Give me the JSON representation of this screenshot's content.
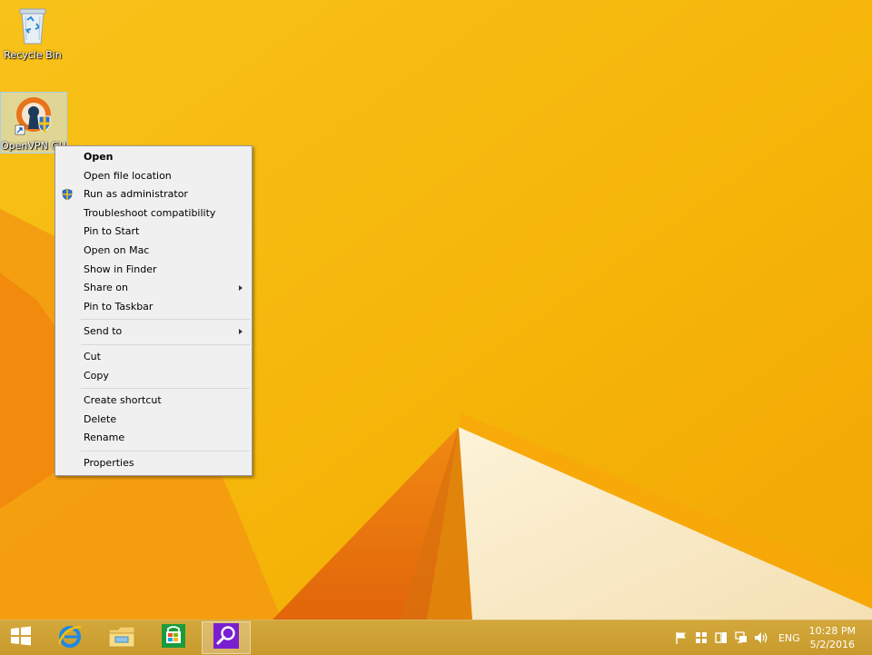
{
  "desktop": {
    "icons": [
      {
        "label": "Recycle Bin"
      },
      {
        "label": "OpenVPN GUI"
      }
    ]
  },
  "context_menu": {
    "items": [
      {
        "label": "Open"
      },
      {
        "label": "Open file location"
      },
      {
        "label": "Run as administrator"
      },
      {
        "label": "Troubleshoot compatibility"
      },
      {
        "label": "Pin to Start"
      },
      {
        "label": "Open on Mac"
      },
      {
        "label": "Show in Finder"
      },
      {
        "label": "Share on"
      },
      {
        "label": "Pin to Taskbar"
      },
      {
        "label": "Send to"
      },
      {
        "label": "Cut"
      },
      {
        "label": "Copy"
      },
      {
        "label": "Create shortcut"
      },
      {
        "label": "Delete"
      },
      {
        "label": "Rename"
      },
      {
        "label": "Properties"
      }
    ]
  },
  "taskbar": {
    "pinned": [
      "windows-start-icon",
      "internet-explorer-icon",
      "file-explorer-icon",
      "store-icon",
      "search-icon"
    ],
    "tray": {
      "language": "ENG",
      "time": "10:28 PM",
      "date": "5/2/2016"
    }
  },
  "colors": {
    "wallpaper": "#f6b60a",
    "taskbar": "#cfa334",
    "menu_bg": "#f0f0f0"
  }
}
